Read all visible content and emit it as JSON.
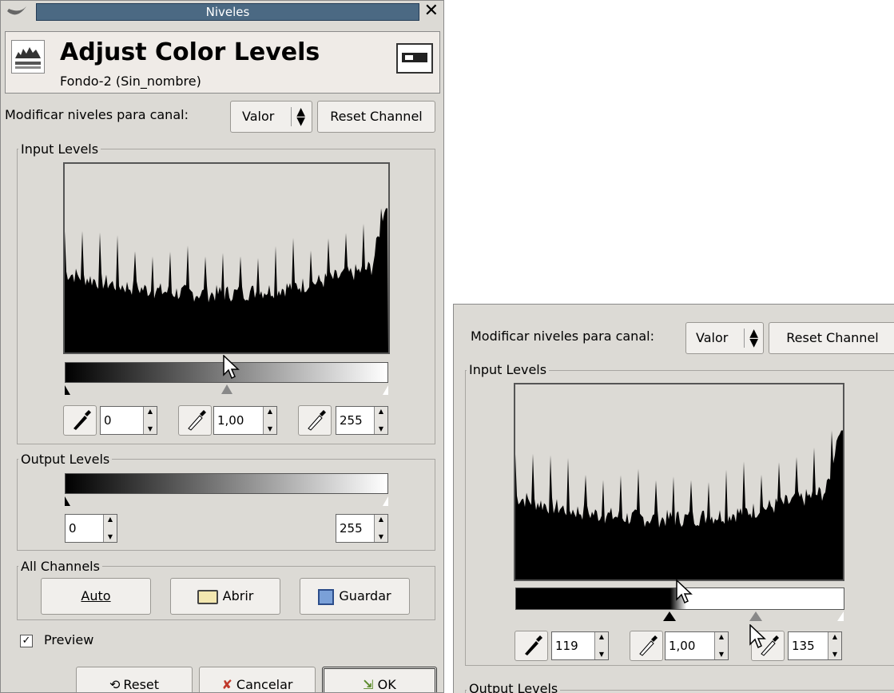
{
  "dialog": {
    "window_title": "Niveles",
    "header_title": "Adjust Color Levels",
    "header_subtitle": "Fondo-2 (Sin_nombre)",
    "channel_label": "Modificar niveles para canal:",
    "channel_value": "Valor",
    "reset_channel": "Reset Channel",
    "input_levels_title": "Input Levels",
    "input_low": "0",
    "input_gamma": "1,00",
    "input_high": "255",
    "output_levels_title": "Output Levels",
    "output_low": "0",
    "output_high": "255",
    "all_channels_title": "All Channels",
    "auto": "Auto",
    "abrir": "Abrir",
    "guardar": "Guardar",
    "preview": "Preview",
    "preview_checked": true,
    "reset": "Reset",
    "cancelar": "Cancelar",
    "ok": "OK"
  },
  "dialog2": {
    "channel_label": "Modificar niveles para canal:",
    "channel_value": "Valor",
    "reset_channel": "Reset Channel",
    "input_levels_title": "Input Levels",
    "input_low": "119",
    "input_gamma": "1,00",
    "input_high": "135",
    "output_levels_title": "Output Levels"
  },
  "colors": {
    "titlebar": "#4b6983",
    "window_bg": "#dcdad5",
    "cancel_x": "#c0392b",
    "ok_icon": "#5a8a2a"
  }
}
